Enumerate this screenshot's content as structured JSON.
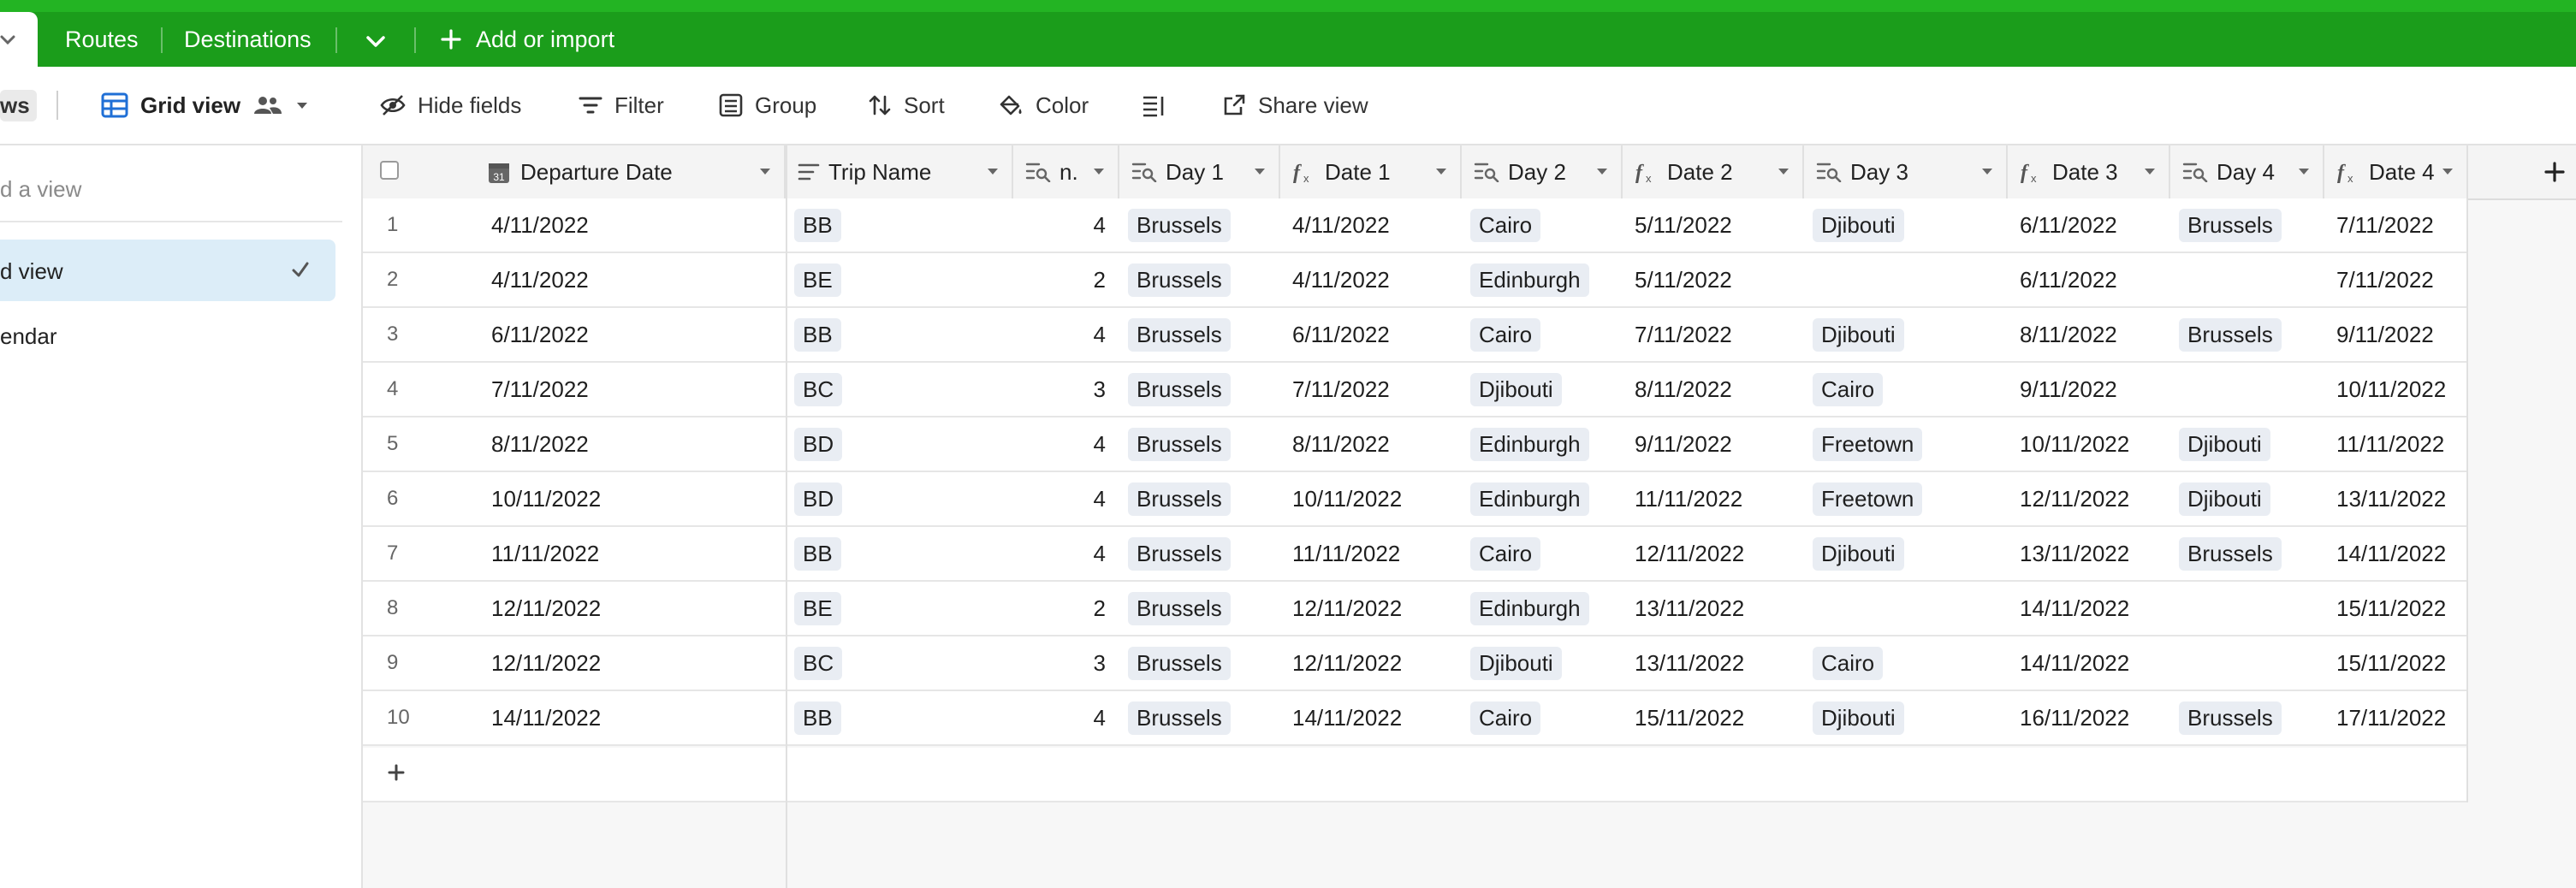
{
  "tabs": {
    "routes": "Routes",
    "destinations": "Destinations",
    "add_or_import": "Add or import"
  },
  "toolbar": {
    "views_label": "ws",
    "grid_view": "Grid view",
    "hide_fields": "Hide fields",
    "filter": "Filter",
    "group": "Group",
    "sort": "Sort",
    "color": "Color",
    "share_view": "Share view"
  },
  "sidebar": {
    "find_placeholder": "d a view",
    "items": [
      {
        "label": "d view",
        "active": true
      },
      {
        "label": "endar",
        "active": false
      }
    ]
  },
  "colors": {
    "topbar": "#1b9d1b",
    "active_view_bg": "#dcedf8",
    "chip_bg": "#e9edf3"
  },
  "columns": [
    {
      "name": "Departure Date",
      "icon": "calendar-icon"
    },
    {
      "name": "Trip Name",
      "icon": "text-field-icon"
    },
    {
      "name": "n.",
      "icon": "lookup-icon"
    },
    {
      "name": "Day 1",
      "icon": "lookup-icon"
    },
    {
      "name": "Date 1",
      "icon": "formula-icon"
    },
    {
      "name": "Day 2",
      "icon": "lookup-icon"
    },
    {
      "name": "Date 2",
      "icon": "formula-icon"
    },
    {
      "name": "Day 3",
      "icon": "lookup-icon"
    },
    {
      "name": "Date 3",
      "icon": "formula-icon"
    },
    {
      "name": "Day 4",
      "icon": "lookup-icon"
    },
    {
      "name": "Date 4",
      "icon": "formula-icon"
    }
  ],
  "rows": [
    {
      "num": "1",
      "departure": "4/11/2022",
      "trip": "BB",
      "n": "4",
      "day1": "Brussels",
      "date1": "4/11/2022",
      "day2": "Cairo",
      "date2": "5/11/2022",
      "day3": "Djibouti",
      "date3": "6/11/2022",
      "day4": "Brussels",
      "date4": "7/11/2022"
    },
    {
      "num": "2",
      "departure": "4/11/2022",
      "trip": "BE",
      "n": "2",
      "day1": "Brussels",
      "date1": "4/11/2022",
      "day2": "Edinburgh",
      "date2": "5/11/2022",
      "day3": "",
      "date3": "6/11/2022",
      "day4": "",
      "date4": "7/11/2022"
    },
    {
      "num": "3",
      "departure": "6/11/2022",
      "trip": "BB",
      "n": "4",
      "day1": "Brussels",
      "date1": "6/11/2022",
      "day2": "Cairo",
      "date2": "7/11/2022",
      "day3": "Djibouti",
      "date3": "8/11/2022",
      "day4": "Brussels",
      "date4": "9/11/2022"
    },
    {
      "num": "4",
      "departure": "7/11/2022",
      "trip": "BC",
      "n": "3",
      "day1": "Brussels",
      "date1": "7/11/2022",
      "day2": "Djibouti",
      "date2": "8/11/2022",
      "day3": "Cairo",
      "date3": "9/11/2022",
      "day4": "",
      "date4": "10/11/2022"
    },
    {
      "num": "5",
      "departure": "8/11/2022",
      "trip": "BD",
      "n": "4",
      "day1": "Brussels",
      "date1": "8/11/2022",
      "day2": "Edinburgh",
      "date2": "9/11/2022",
      "day3": "Freetown",
      "date3": "10/11/2022",
      "day4": "Djibouti",
      "date4": "11/11/2022"
    },
    {
      "num": "6",
      "departure": "10/11/2022",
      "trip": "BD",
      "n": "4",
      "day1": "Brussels",
      "date1": "10/11/2022",
      "day2": "Edinburgh",
      "date2": "11/11/2022",
      "day3": "Freetown",
      "date3": "12/11/2022",
      "day4": "Djibouti",
      "date4": "13/11/2022"
    },
    {
      "num": "7",
      "departure": "11/11/2022",
      "trip": "BB",
      "n": "4",
      "day1": "Brussels",
      "date1": "11/11/2022",
      "day2": "Cairo",
      "date2": "12/11/2022",
      "day3": "Djibouti",
      "date3": "13/11/2022",
      "day4": "Brussels",
      "date4": "14/11/2022"
    },
    {
      "num": "8",
      "departure": "12/11/2022",
      "trip": "BE",
      "n": "2",
      "day1": "Brussels",
      "date1": "12/11/2022",
      "day2": "Edinburgh",
      "date2": "13/11/2022",
      "day3": "",
      "date3": "14/11/2022",
      "day4": "",
      "date4": "15/11/2022"
    },
    {
      "num": "9",
      "departure": "12/11/2022",
      "trip": "BC",
      "n": "3",
      "day1": "Brussels",
      "date1": "12/11/2022",
      "day2": "Djibouti",
      "date2": "13/11/2022",
      "day3": "Cairo",
      "date3": "14/11/2022",
      "day4": "",
      "date4": "15/11/2022"
    },
    {
      "num": "10",
      "departure": "14/11/2022",
      "trip": "BB",
      "n": "4",
      "day1": "Brussels",
      "date1": "14/11/2022",
      "day2": "Cairo",
      "date2": "15/11/2022",
      "day3": "Djibouti",
      "date3": "16/11/2022",
      "day4": "Brussels",
      "date4": "17/11/2022"
    }
  ]
}
